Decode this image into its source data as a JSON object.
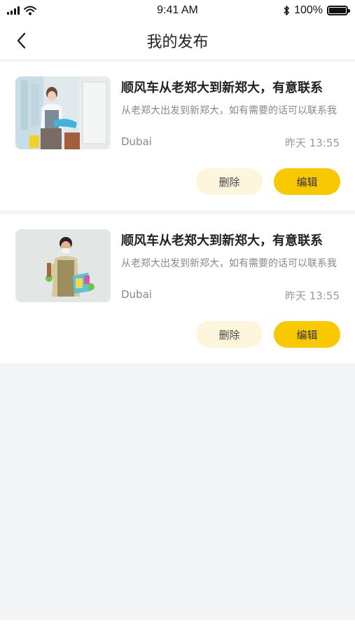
{
  "status_bar": {
    "time": "9:41 AM",
    "battery": "100%",
    "icons": [
      "signal-icon",
      "wifi-icon",
      "bluetooth-icon",
      "battery-icon"
    ]
  },
  "nav": {
    "title": "我的发布",
    "back_icon": "chevron-left-icon"
  },
  "posts": [
    {
      "title": "顺风车从老郑大到新郑大，有意联系",
      "description": "从老郑大出发到新郑大，如有需要的话可以联系我",
      "location": "Dubai",
      "time": "昨天 13:55",
      "delete_label": "删除",
      "edit_label": "编辑"
    },
    {
      "title": "顺风车从老郑大到新郑大，有意联系",
      "description": "从老郑大出发到新郑大，如有需要的话可以联系我",
      "location": "Dubai",
      "time": "昨天 13:55",
      "delete_label": "删除",
      "edit_label": "编辑"
    }
  ],
  "colors": {
    "accent": "#f8c800",
    "delete_bg": "#fdf6dc",
    "page_bg": "#f4f5f7"
  }
}
